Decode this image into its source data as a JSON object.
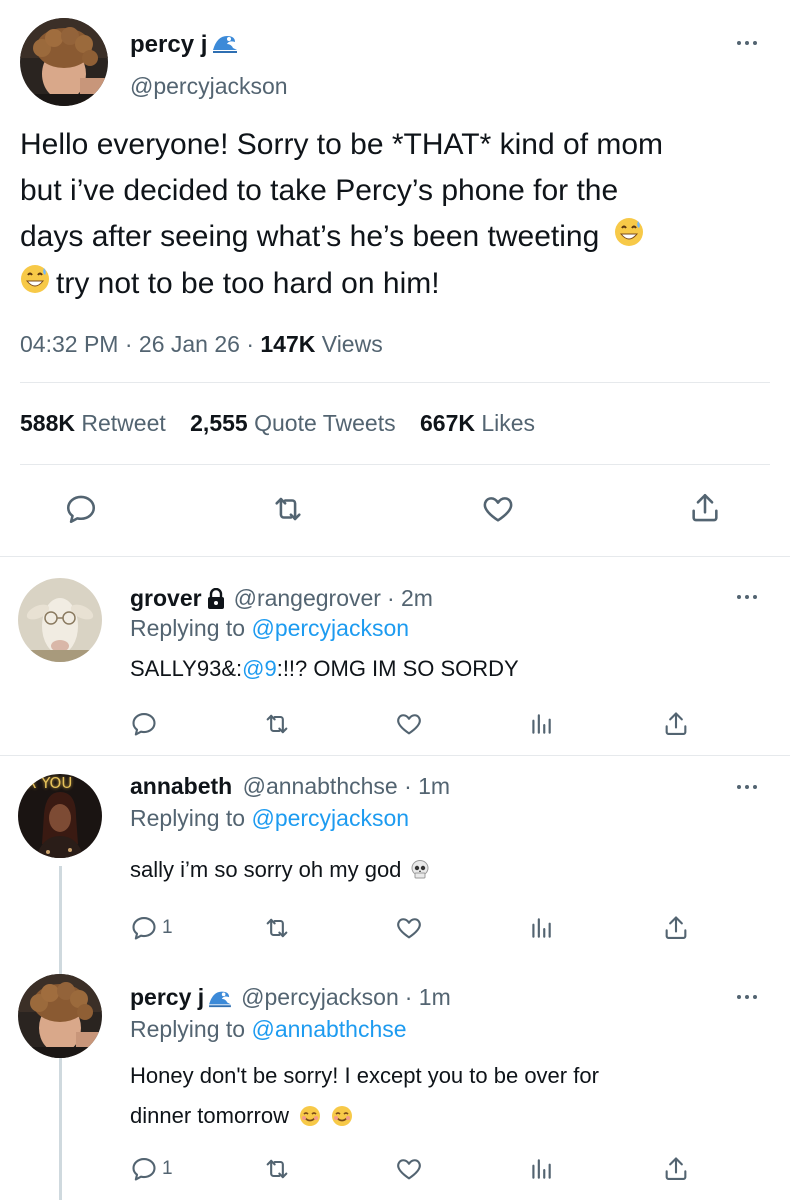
{
  "main_tweet": {
    "author_name": "percy j",
    "name_badge": "wave-emoji",
    "handle": "@percyjackson",
    "text_lines": [
      "Hello everyone! Sorry to be *THAT* kind of mom",
      "but i’ve decided to take Percy’s phone for the",
      "days after seeing what’s he’s been tweeting",
      "try not to be too hard on him!"
    ],
    "emoji": "grinning-sweat-emoji",
    "time": "04:32 PM",
    "date": "26 Jan 26",
    "views_count": "147K",
    "views_label": "Views",
    "separator": "·",
    "retweets_count": "588K",
    "retweets_label": "Retweet",
    "quotes_count": "2,555",
    "quotes_label": "Quote Tweets",
    "likes_count": "667K",
    "likes_label": "Likes"
  },
  "replies": [
    {
      "name": "grover",
      "badge": "lock-icon",
      "handle": "@rangegrover",
      "time": "· 2m",
      "replying_label": "Replying to",
      "replying_to": "@percyjackson",
      "text_parts": [
        "SALLY93&:",
        "@9",
        ":!!? OMG IM SO SORDY"
      ],
      "reply_count": "",
      "avatar": "goat"
    },
    {
      "name": "annabeth",
      "handle": "@annabthchse",
      "time": "· 1m",
      "replying_label": "Replying to",
      "replying_to": "@percyjackson",
      "text": "sally i’m so sorry oh my god",
      "emoji": "skull-emoji",
      "reply_count": "1",
      "avatar_sign": "R YOU"
    },
    {
      "name": "percy j",
      "badge": "wave-emoji",
      "handle": "@percyjackson",
      "time": "· 1m",
      "replying_label": "Replying to",
      "replying_to": "@annabthchse",
      "text_lines": [
        "Honey don't be sorry! I except you to be over for",
        "dinner tomorrow"
      ],
      "emoji": "relieved-smile-emoji",
      "reply_count": "1"
    }
  ],
  "colors": {
    "text": "#0f1419",
    "secondary": "#536471",
    "link": "#1d9bf0",
    "divider": "#e6e9ec"
  }
}
